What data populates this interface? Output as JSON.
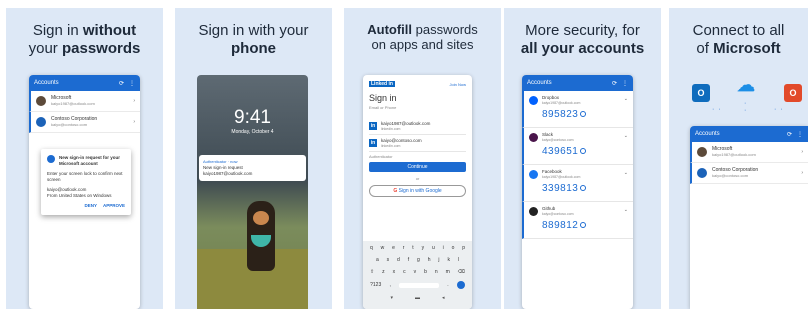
{
  "panels": [
    {
      "title_normal_1": "Sign in ",
      "title_bold_1": "without",
      "title_normal_2": "your ",
      "title_bold_2": "passwords"
    },
    {
      "title_normal_1": "Sign in with your",
      "title_bold_2": "phone"
    },
    {
      "title_bold_1": "Autofill",
      "title_normal_1": " passwords",
      "title_normal_2": "on apps and sites"
    },
    {
      "title_normal_1": "More security, for",
      "title_bold_2": "all your accounts"
    },
    {
      "title_normal_1": "Connect to all",
      "title_normal_2": "of ",
      "title_bold_2": "Microsoft"
    }
  ],
  "screen1": {
    "appbar_title": "Accounts",
    "refresh_icon": "⟳",
    "menu_icon": "⋮",
    "accounts": [
      {
        "name": "Microsoft",
        "email": "kaiyo1987@outlook.com"
      },
      {
        "name": "Contoso Corporation",
        "email": "kaiyo@contoso.com"
      }
    ],
    "dialog": {
      "title": "New sign-in request for your Microsoft account",
      "line1": "Enter your screen lock to confirm next screen",
      "email": "kaiyo@outlook.com",
      "location": "From United States on Windows",
      "deny": "DENY",
      "approve": "APPROVE"
    }
  },
  "screen2": {
    "time": "9:41",
    "date": "Monday, October 4",
    "notif_app": "Authenticator · now",
    "notif_title": "New sign-in request",
    "notif_email": "kaiyo1987@outlook.com"
  },
  "screen3": {
    "brand": "Linked in",
    "help": "Join Now",
    "heading": "Sign in",
    "subheading": "Email or Phone",
    "creds": [
      {
        "email": "kaiyo1987@outlook.com",
        "site": "linkedin.com"
      },
      {
        "email": "kaiyo@contoso.com",
        "site": "linkedin.com"
      }
    ],
    "field_hint": "Authenticator",
    "continue": "Continue",
    "or": "or",
    "google": "Sign in with Google",
    "kb_row1": [
      "q",
      "w",
      "e",
      "r",
      "t",
      "y",
      "u",
      "i",
      "o",
      "p"
    ],
    "kb_row2": [
      "a",
      "s",
      "d",
      "f",
      "g",
      "h",
      "j",
      "k",
      "l"
    ],
    "kb_row3": [
      "⇧",
      "z",
      "x",
      "c",
      "v",
      "b",
      "n",
      "m",
      "⌫"
    ],
    "kb_row4_left": "?123",
    "kb_row4_comma": ",",
    "kb_row4_dot": ".",
    "nav": [
      "▾",
      "▬",
      "◂"
    ]
  },
  "screen4": {
    "appbar_title": "Accounts",
    "refresh_icon": "⟳",
    "menu_icon": "⋮",
    "items": [
      {
        "name": "Dropbox",
        "email": "kaiyo1987@outlook.com",
        "code": "895823",
        "color": "#0061fe"
      },
      {
        "name": "Slack",
        "email": "kaiyo@contoso.com",
        "code": "439651",
        "color": "#4a154b"
      },
      {
        "name": "Facebook",
        "email": "kaiyo1987@outlook.com",
        "code": "339813",
        "color": "#1877f2"
      },
      {
        "name": "Github",
        "email": "kaiyo@contoso.com",
        "code": "889812",
        "color": "#222222"
      }
    ]
  },
  "screen5": {
    "apps": [
      {
        "icon": "outlook-icon",
        "glyph": "O",
        "color": "#0f6cbd"
      },
      {
        "icon": "onedrive-icon",
        "glyph": "☁",
        "color": "#1c8ee6"
      },
      {
        "icon": "office-icon",
        "glyph": "O",
        "color": "#e24a2a"
      }
    ],
    "appbar_title": "Accounts",
    "refresh_icon": "⟳",
    "menu_icon": "⋮",
    "accounts": [
      {
        "name": "Microsoft",
        "email": "kaiyo1987@outlook.com"
      },
      {
        "name": "Contoso Corporation",
        "email": "kaiyo@contoso.com"
      }
    ]
  }
}
